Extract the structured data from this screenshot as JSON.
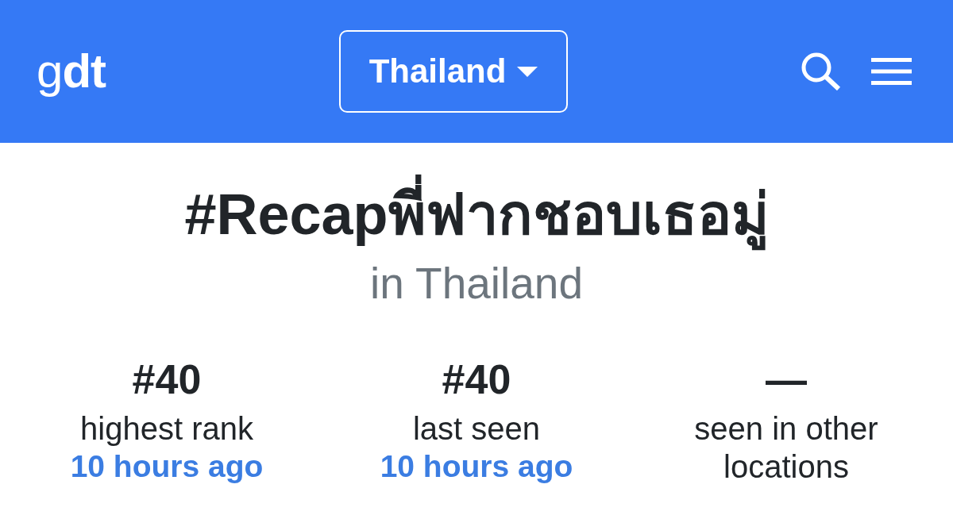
{
  "header": {
    "logo": "g**dt**",
    "location_dropdown": {
      "label": "Thailand"
    }
  },
  "trend": {
    "title": "#Recapพี่ฟากชอบเธอมู่",
    "subtitle": "in Thailand"
  },
  "stats": [
    {
      "value": "#40",
      "label": "highest rank",
      "time": "10 hours ago"
    },
    {
      "value": "#40",
      "label": "last seen",
      "time": "10 hours ago"
    },
    {
      "value": "—",
      "label": "seen in other locations"
    }
  ]
}
